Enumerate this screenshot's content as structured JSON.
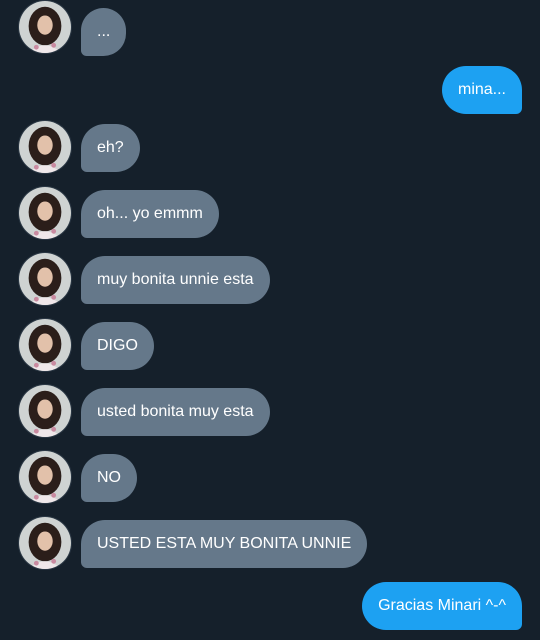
{
  "conversation": {
    "messages": [
      {
        "side": "in",
        "text": "..."
      },
      {
        "side": "out",
        "text": "mina..."
      },
      {
        "side": "in",
        "text": "eh?"
      },
      {
        "side": "in",
        "text": "oh... yo emmm"
      },
      {
        "side": "in",
        "text": "muy bonita unnie esta"
      },
      {
        "side": "in",
        "text": "DIGO"
      },
      {
        "side": "in",
        "text": "usted bonita muy esta"
      },
      {
        "side": "in",
        "text": "NO"
      },
      {
        "side": "in",
        "text": "USTED ESTA MUY BONITA UNNIE"
      },
      {
        "side": "out",
        "text": "Gracias Minari ^-^"
      }
    ]
  },
  "colors": {
    "background": "#15202b",
    "incoming_bubble": "#65788a",
    "outgoing_bubble": "#1da1f2",
    "text": "#ffffff"
  }
}
